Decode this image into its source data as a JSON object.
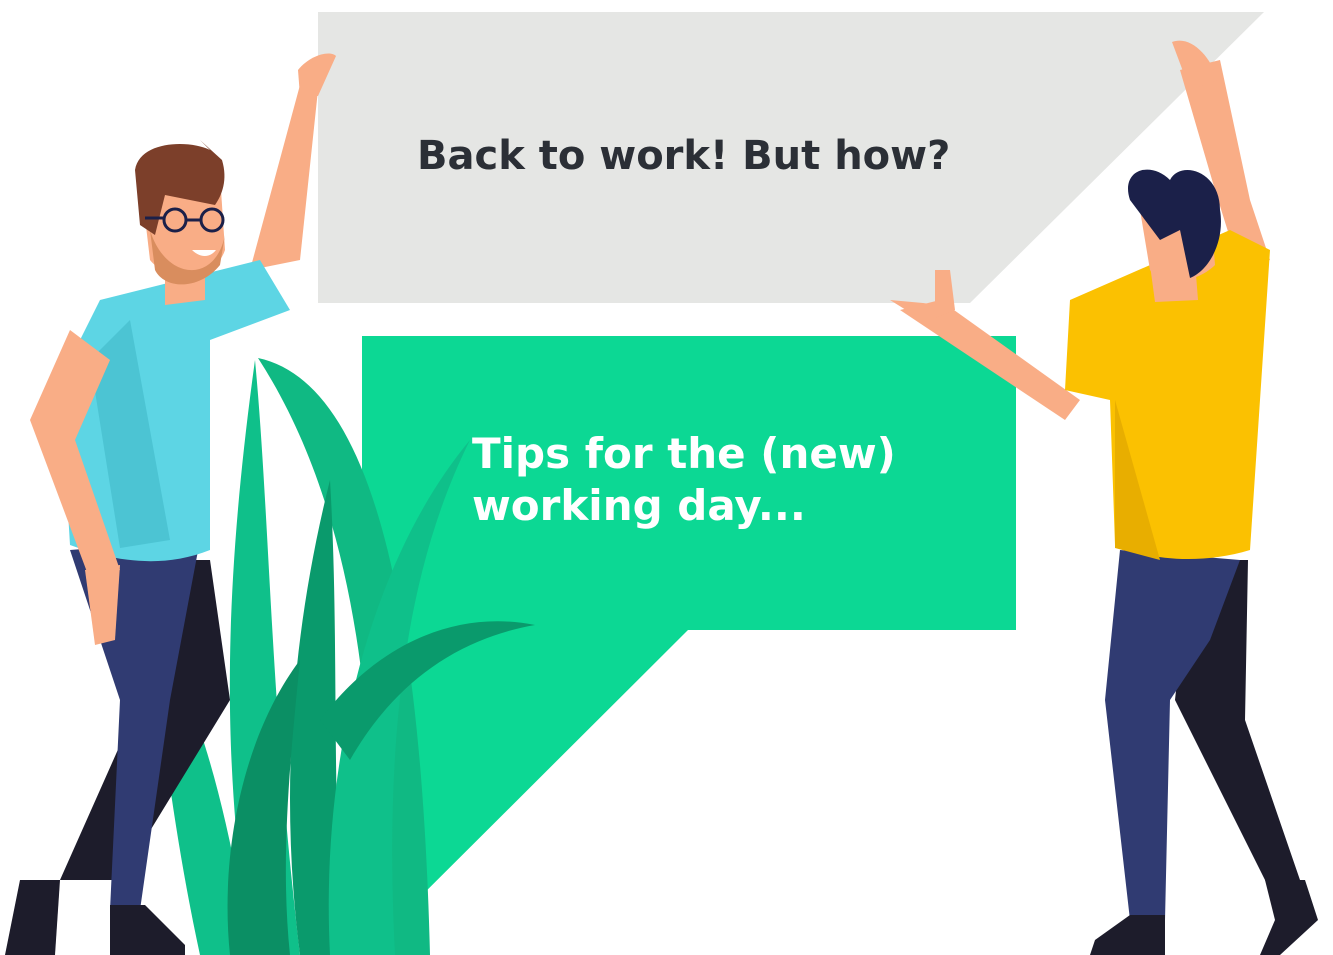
{
  "banner": {
    "title": "Back to work! But how?",
    "color": "#e5e6e4"
  },
  "bubble": {
    "line1": "Tips for the (new)",
    "line2": "working day...",
    "color": "#0cd894"
  },
  "characters": {
    "left_man": {
      "shirt": "#5dd5e4",
      "pants": "#303b72",
      "hair": "#7c3f2a",
      "skin": "#f9ad86"
    },
    "right_man": {
      "shirt": "#fbc101",
      "pants": "#303b72",
      "hair": "#1b2049",
      "skin": "#f9ad86"
    }
  },
  "plant": {
    "color": "#0fc08a"
  }
}
